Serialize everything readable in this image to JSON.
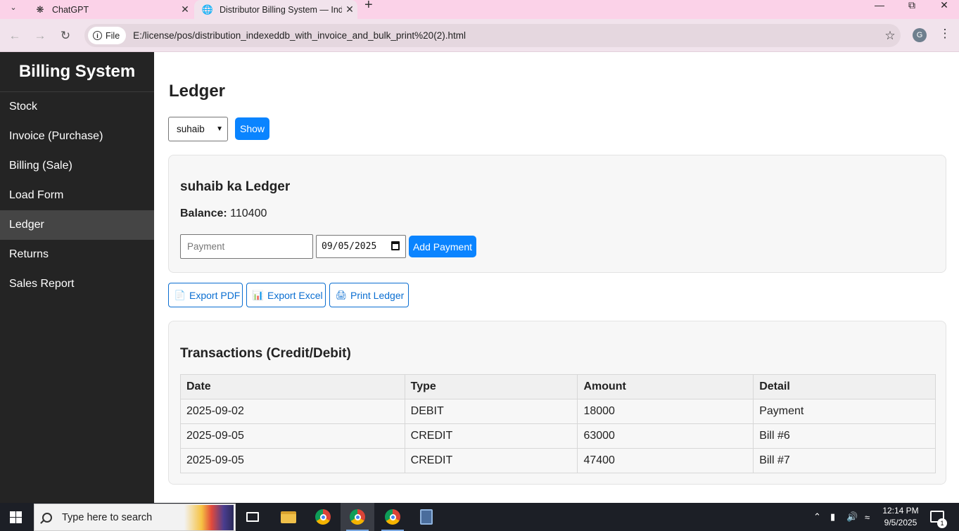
{
  "browser": {
    "tabs": [
      {
        "title": "ChatGPT",
        "icon": "chatgpt-icon"
      },
      {
        "title": "Distributor Billing System — Ind",
        "icon": "globe-icon"
      }
    ],
    "chip_label": "File",
    "url": "E:/license/pos/distribution_indexeddb_with_invoice_and_bulk_print%20(2).html",
    "profile_initial": "G"
  },
  "sidebar": {
    "brand": "Billing System",
    "items": [
      {
        "label": "Stock"
      },
      {
        "label": "Invoice (Purchase)"
      },
      {
        "label": "Billing (Sale)"
      },
      {
        "label": "Load Form"
      },
      {
        "label": "Ledger",
        "active": true
      },
      {
        "label": "Returns"
      },
      {
        "label": "Sales Report"
      }
    ]
  },
  "main": {
    "title": "Ledger",
    "party_select": {
      "value": "suhaib"
    },
    "show_label": "Show",
    "ledger_card": {
      "heading": "suhaib ka Ledger",
      "balance_label": "Balance:",
      "balance_value": "110400",
      "payment_placeholder": "Payment",
      "date_value": "09/05/2025",
      "add_payment_label": "Add Payment"
    },
    "exports": {
      "pdf_label": "Export PDF",
      "excel_label": "Export Excel",
      "print_label": "Print Ledger"
    },
    "transactions": {
      "heading": "Transactions (Credit/Debit)",
      "columns": [
        "Date",
        "Type",
        "Amount",
        "Detail"
      ],
      "rows": [
        [
          "2025-09-02",
          "DEBIT",
          "18000",
          "Payment"
        ],
        [
          "2025-09-05",
          "CREDIT",
          "63000",
          "Bill #6"
        ],
        [
          "2025-09-05",
          "CREDIT",
          "47400",
          "Bill #7"
        ]
      ]
    }
  },
  "taskbar": {
    "search_placeholder": "Type here to search",
    "time": "12:14 PM",
    "date": "9/5/2025",
    "notification_count": "1"
  },
  "colors": {
    "accent": "#0a84ff",
    "sidebar_bg": "#242424",
    "sidebar_active": "#454545",
    "tabstrip": "#fbd2e8"
  }
}
